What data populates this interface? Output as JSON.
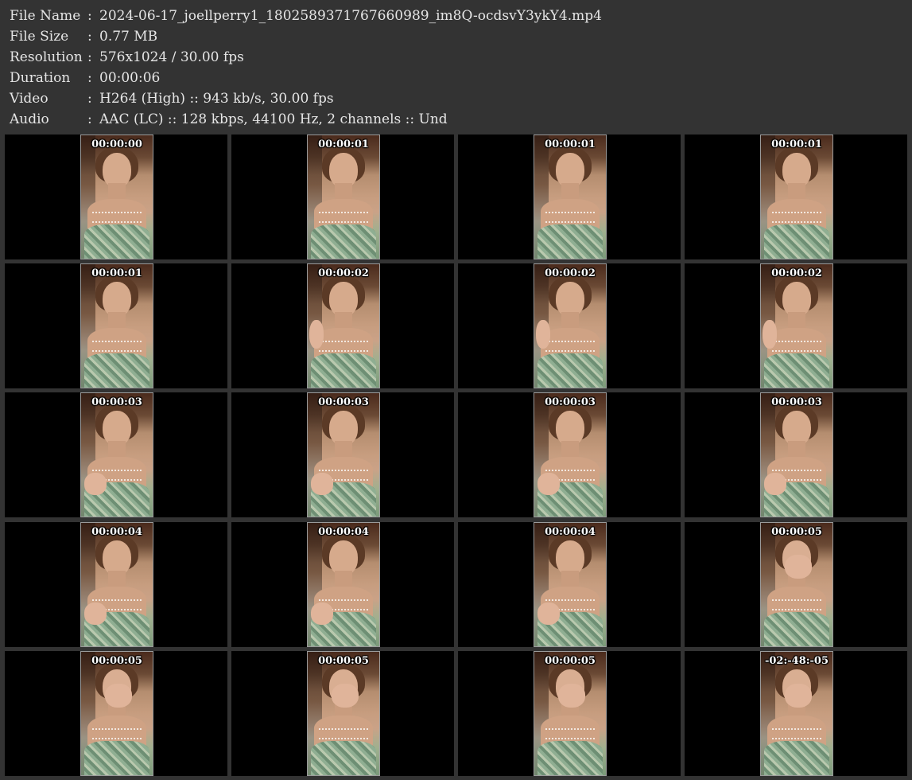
{
  "info": {
    "file_name": {
      "label": "File Name",
      "value": "2024-06-17_joellperry1_1802589371767660989_im8Q-ocdsvY3ykY4.mp4"
    },
    "file_size": {
      "label": "File Size",
      "value": "0.77 MB"
    },
    "resolution": {
      "label": "Resolution",
      "value": "576x1024 / 30.00 fps"
    },
    "duration": {
      "label": "Duration",
      "value": "00:00:06"
    },
    "video": {
      "label": "Video",
      "value": "H264 (High) :: 943 kb/s, 30.00 fps"
    },
    "audio": {
      "label": "Audio",
      "value": "AAC (LC) :: 128 kbps, 44100 Hz, 2 channels :: Und"
    },
    "separator": ":"
  },
  "thumbnails": [
    {
      "time": "00:00:00"
    },
    {
      "time": "00:00:01"
    },
    {
      "time": "00:00:01"
    },
    {
      "time": "00:00:01"
    },
    {
      "time": "00:00:01"
    },
    {
      "time": "00:00:02"
    },
    {
      "time": "00:00:02"
    },
    {
      "time": "00:00:02"
    },
    {
      "time": "00:00:03"
    },
    {
      "time": "00:00:03"
    },
    {
      "time": "00:00:03"
    },
    {
      "time": "00:00:03"
    },
    {
      "time": "00:00:04"
    },
    {
      "time": "00:00:04"
    },
    {
      "time": "00:00:04"
    },
    {
      "time": "00:00:05"
    },
    {
      "time": "00:00:05"
    },
    {
      "time": "00:00:05"
    },
    {
      "time": "00:00:05"
    },
    {
      "time": "-02:-48:-05"
    }
  ],
  "colors": {
    "background": "#333333",
    "cell_background": "#000000",
    "text": "#e6e6e6",
    "timestamp": "#ffffff"
  }
}
